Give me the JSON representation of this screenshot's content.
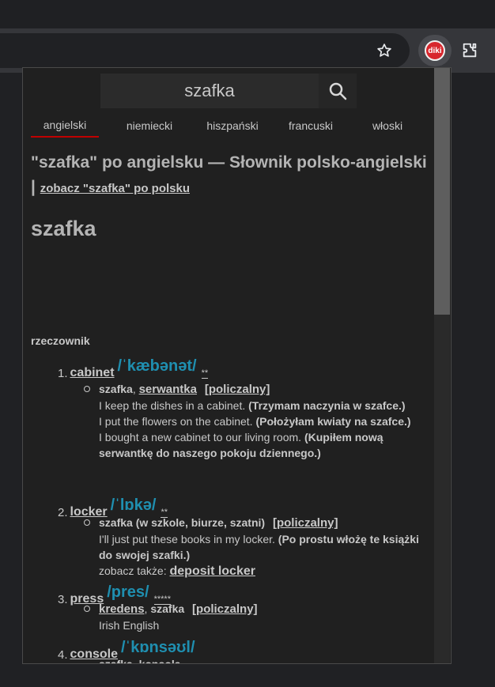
{
  "browser": {
    "extension_icon_text": "diki"
  },
  "popup": {
    "search": {
      "value": "szafka"
    },
    "tabs": [
      {
        "label": "angielski",
        "active": true
      },
      {
        "label": "niemiecki",
        "active": false
      },
      {
        "label": "hiszpański",
        "active": false
      },
      {
        "label": "francuski",
        "active": false
      },
      {
        "label": "włoski",
        "active": false
      }
    ],
    "heading": {
      "text": "\"szafka\" po angielsku — Słownik polsko-angielski |",
      "link": "zobacz \"szafka\" po polsku"
    },
    "word": "szafka",
    "part_of_speech": "rzeczownik",
    "entries": [
      {
        "num": "1.",
        "headword": "cabinet",
        "ipa": "/ˈkæbənət/",
        "stars": "**",
        "sense": {
          "translation": "szafka",
          "syn_sep": ",",
          "synonym": "serwantka",
          "register": "[policzalny]"
        },
        "examples": [
          {
            "en": "I keep the dishes in a cabinet.",
            "pl": "(Trzymam naczynia w szafce.)"
          },
          {
            "en": "I put the flowers on the cabinet.",
            "pl": "(Położyłam kwiaty na szafce.)"
          },
          {
            "en": "I bought a new cabinet to our living room.",
            "pl": "(Kupiłem nową serwantkę do naszego pokoju dziennego.)"
          }
        ]
      },
      {
        "num": "2.",
        "headword": "locker",
        "ipa": "/ˈlɒkə/",
        "stars": "**",
        "sense": {
          "translation": "szafka (w szkole, biurze, szatni)",
          "register": "[policzalny]"
        },
        "examples": [
          {
            "en": "I'll just put these books in my locker.",
            "pl": "(Po prostu włożę te książki do swojej szafki.)"
          }
        ],
        "see_also": {
          "label": "zobacz także:",
          "link": "deposit locker"
        }
      },
      {
        "num": "3.",
        "headword": "press",
        "ipa": "/pres/",
        "stars": "*****",
        "sense": {
          "translation_link": "kredens",
          "syn_sep": ",",
          "synonym_plain": "szafka",
          "register": "[policzalny]"
        },
        "note": "Irish English"
      },
      {
        "num": "4.",
        "headword": "console",
        "ipa": "/ˈkɒnsəʊl/",
        "sense_partial": "szafka, konsola"
      }
    ]
  }
}
